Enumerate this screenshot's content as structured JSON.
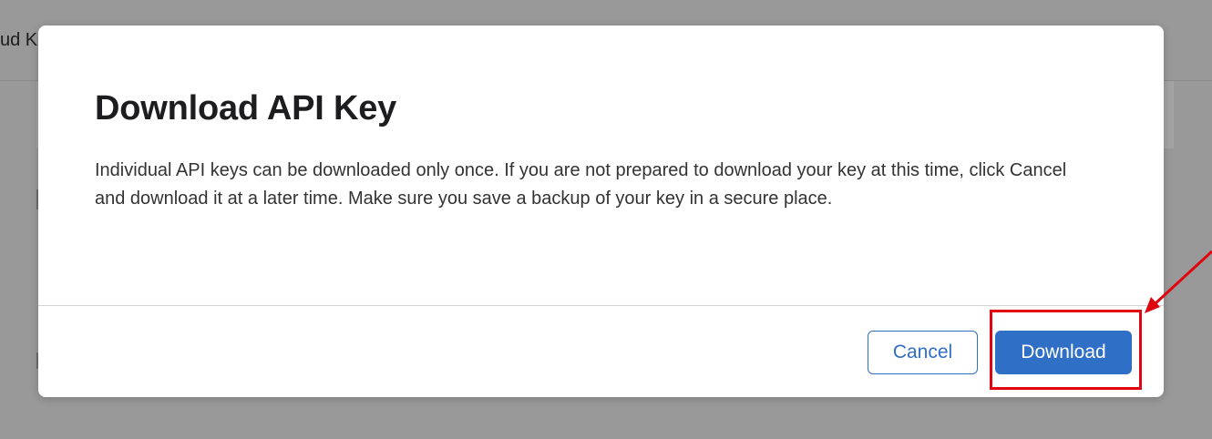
{
  "background": {
    "page_title_fragment": "ud K"
  },
  "dialog": {
    "title": "Download API Key",
    "message": "Individual API keys can be downloaded only once. If you are not prepared to download your key at this time, click Cancel and download it at a later time. Make sure you save a backup of your key in a secure place.",
    "cancel_label": "Cancel",
    "download_label": "Download"
  },
  "annotation": {
    "color": "#e0060f",
    "target": "download-button"
  },
  "colors": {
    "overlay": "#999999",
    "accent": "#2f6fc6",
    "title_text": "#1d1d1f",
    "body_text": "#333333"
  }
}
